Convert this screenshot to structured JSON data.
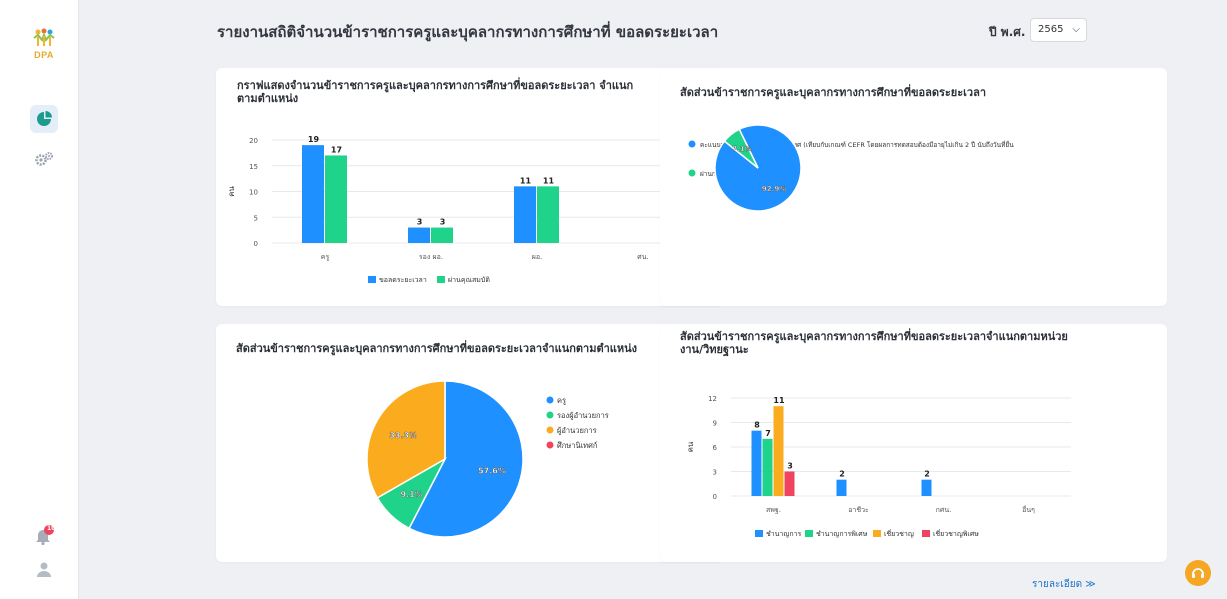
{
  "sidebar": {
    "logo_text": "DPA",
    "bell_badge": "10"
  },
  "header": {
    "title": "รายงานสถิติจำนวนข้าราชการครูและบุคลากรทางการศึกษาที่ ขอลดระยะเวลา",
    "year_label": "ปี พ.ศ.",
    "year_value": "2565"
  },
  "cards": {
    "bar1_title_line1": "กราฟแสดงจำนวนข้าราชการครูและบุคลากรทางการศึกษาที่ขอลดระยะเวลา จำแนก",
    "bar1_title_line2": "ตามตำแหน่ง",
    "pie1_title": "สัดส่วนข้าราชการครูและบุคลากรทางการศึกษาที่ขอลดระยะเวลา",
    "pie2_title": "สัดส่วนข้าราชการครูและบุคลากรทางการศึกษาที่ขอลดระยะเวลาจำแนกตามตำแหน่ง",
    "bar2_title_line1": "สัดส่วนข้าราชการครูและบุคลากรทางการศึกษาที่ขอลดระยะเวลาจำแนกตามหน่วย",
    "bar2_title_line2": "งาน/วิทยฐานะ"
  },
  "footer": {
    "detail_link": "รายละเอียด ≫"
  },
  "colors": {
    "blue": "#1e90ff",
    "green": "#1fd38a",
    "orange": "#fbac1e",
    "red": "#f0435f"
  },
  "chart_data": [
    {
      "type": "bar",
      "categories": [
        "ครู",
        "รอง ผอ.",
        "ผอ.",
        "ศน."
      ],
      "series": [
        {
          "name": "ขอลดระยะเวลา",
          "values": [
            19,
            3,
            11,
            0
          ]
        },
        {
          "name": "ผ่านคุณสมบัติ",
          "values": [
            17,
            3,
            11,
            0
          ]
        }
      ],
      "ylabel": "คน",
      "ylim": [
        0,
        20
      ],
      "yticks": [
        0,
        5,
        10,
        15,
        20
      ],
      "grid": true,
      "legend": "bottom"
    },
    {
      "type": "pie",
      "labels": [
        "คะแนนทดสอบทางภาษาต่างประเทศ (เทียบกับเกณฑ์ CEFR โดยผลการทดสอบต้องมีอายุไม่เกิน 2 ปี นับถึงวันที่ยื่น",
        "ผ่านกรอบคุณวุฒิวิชาชีพชั้น 8"
      ],
      "values": [
        92.9,
        7.1
      ],
      "data_labels": [
        "92.9%",
        "7.1%"
      ],
      "legend": "overlapping-left"
    },
    {
      "type": "pie",
      "labels": [
        "ครู",
        "รองผู้อำนวยการ",
        "ผู้อำนวยการ",
        "ศึกษานิเทศก์"
      ],
      "values": [
        57.6,
        9.1,
        33.3,
        0
      ],
      "data_labels": [
        "57.6%",
        "9.1%",
        "33.3%",
        ""
      ],
      "legend": "right"
    },
    {
      "type": "bar",
      "categories": [
        "สพฐ.",
        "อาชีวะ",
        "กศน.",
        "อื่นๆ"
      ],
      "series": [
        {
          "name": "ชำนาญการ",
          "values": [
            8,
            2,
            2,
            0
          ]
        },
        {
          "name": "ชำนาญการพิเศษ",
          "values": [
            7,
            0,
            0,
            0
          ]
        },
        {
          "name": "เชี่ยวชาญ",
          "values": [
            11,
            0,
            0,
            0
          ]
        },
        {
          "name": "เชี่ยวชาญพิเศษ",
          "values": [
            3,
            0,
            0,
            0
          ]
        }
      ],
      "ylabel": "คน",
      "ylim": [
        0,
        12
      ],
      "yticks": [
        0,
        3,
        6,
        9,
        12
      ],
      "grid": true,
      "legend": "bottom"
    }
  ]
}
